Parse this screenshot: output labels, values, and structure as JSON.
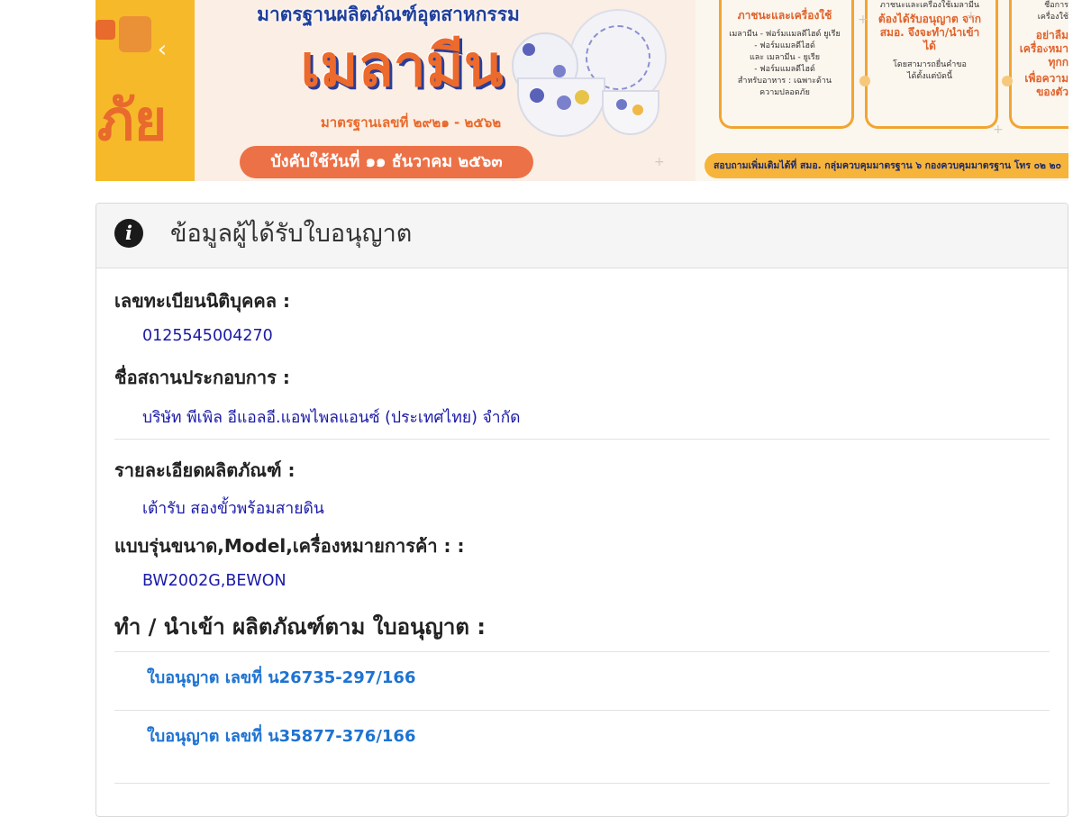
{
  "banner": {
    "left_glyph": "ภัย",
    "top_title": "มาตรฐานผลิตภัณฑ์อุตสาหกรรม",
    "big_title": "เมลามีน",
    "standard_no": "มาตรฐานเลขที่ ๒๙๒๑ - ๒๕๖๒",
    "effective_date": "บังคับใช้วันที่ ๑๑ ธันวาคม ๒๕๖๓",
    "flow": {
      "col1_heading": "ภาชนะและเครื่องใช้",
      "col1_lines": [
        "เมลามีน - ฟอร์มแมลดีไฮด์ ยูเรีย",
        "- ฟอร์มแมลดีไฮด์",
        "และ เมลามีน - ยูเรีย",
        "- ฟอร์มแมลดีไฮด์",
        "สำหรับอาหาร : เฉพาะด้าน",
        "ความปลอดภัย"
      ],
      "col2_top": "ภาชนะและเครื่องใช้เมลามีน",
      "col2_heading": "ต้องได้รับอนุญาต จาก สมอ. จึงจะทำ/นำเข้าได้",
      "col2_lines": [
        "โดยสามารถยื่นคำขอ",
        "ได้ตั้งแต่บัดนี้"
      ],
      "col3_lines": [
        "ชื่อการ",
        "เครื่องใช้"
      ],
      "col3_heading": "อย่าลืม เครื่องหมา ทุกก",
      "col3_tail": "เพื่อความ ของตัว"
    },
    "contact": "สอบถามเพิ่มเติมได้ที่ สมอ. กลุ่มควบคุมมาตรฐาน ๖ กองควบคุมมาตรฐาน โทร ๐๒ ๒๐"
  },
  "panel": {
    "title": "ข้อมูลผู้ได้รับใบอนุญาต",
    "fields": [
      {
        "label": "เลขทะเบียนนิติบุคคล :",
        "value": "0125545004270"
      },
      {
        "label": "ชื่อสถานประกอบการ :",
        "value": "บริษัท พีเพิล อีแอลอี.แอพไพลแอนซ์ (ประเทศไทย) จำกัด"
      },
      {
        "label": "รายละเอียดผลิตภัณฑ์ :",
        "value": "เต้ารับ สองขั้วพร้อมสายดิน"
      },
      {
        "label": "แบบรุ่นขนาด,Model,เครื่องหมายการค้า : :",
        "value": "BW2002G,BEWON"
      }
    ],
    "licenses_heading": "ทำ / นำเข้า ผลิตภัณฑ์ตาม ใบอนุญาต :",
    "licenses": [
      "ใบอนุญาต เลขที่ น26735-297/166",
      "ใบอนุญาต เลขที่ น35877-376/166"
    ]
  }
}
